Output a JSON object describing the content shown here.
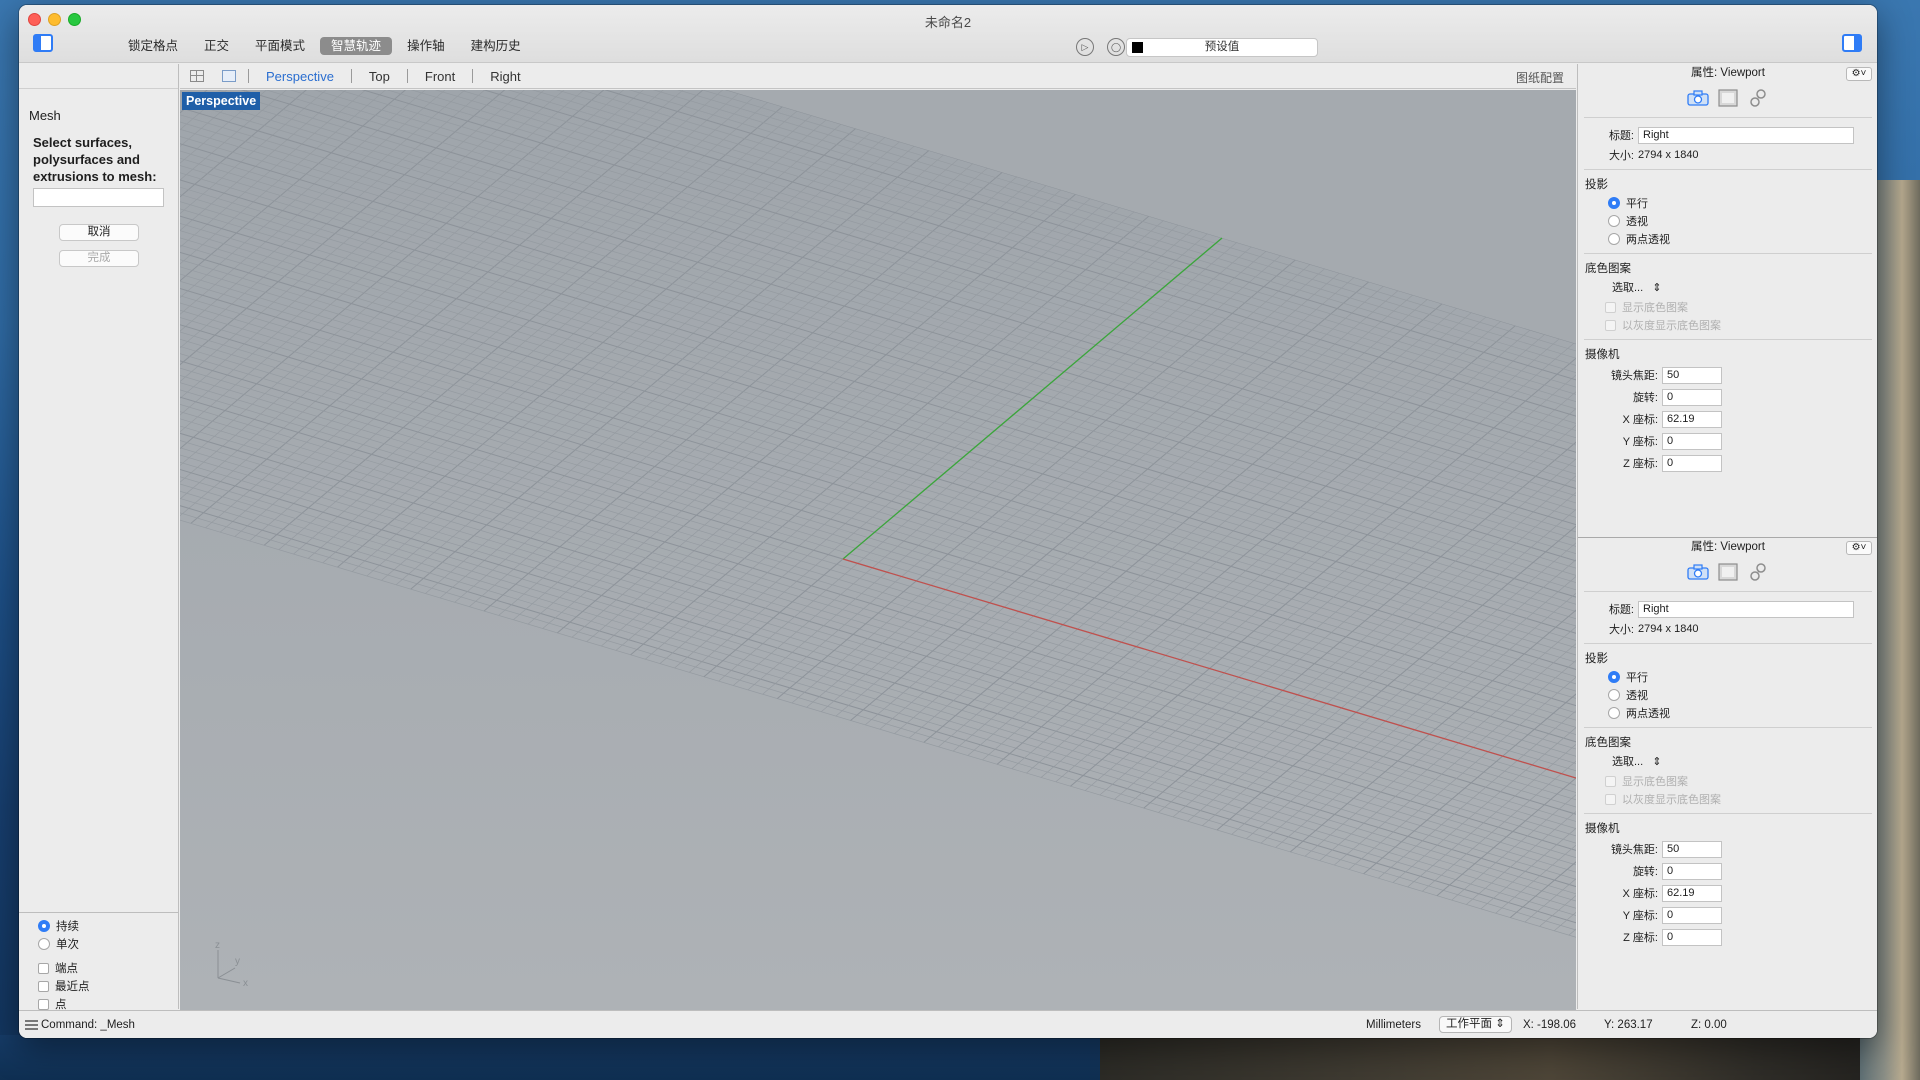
{
  "window": {
    "title": "未命名2",
    "modes": [
      "锁定格点",
      "正交",
      "平面模式",
      "智慧轨迹",
      "操作轴",
      "建构历史"
    ],
    "active_mode_index": 3,
    "preset_label": "预设值"
  },
  "command": {
    "name": "Mesh",
    "prompt": "Select surfaces, polysurfaces and extrusions to mesh:",
    "input_value": "",
    "cancel_label": "取消",
    "done_label": "完成",
    "osnap_radio": [
      "持续",
      "单次"
    ],
    "osnap_radio_selected": 0,
    "osnap_checks": [
      "端点",
      "最近点",
      "点"
    ]
  },
  "viewport_tabs": {
    "tabs": [
      "Perspective",
      "Top",
      "Front",
      "Right"
    ],
    "active_tab": "Perspective",
    "layout_label": "图纸配置"
  },
  "viewport": {
    "label": "Perspective",
    "axis_letters": {
      "z": "z",
      "y": "y",
      "x": "x"
    }
  },
  "properties": [
    {
      "header": "属性: Viewport",
      "title_label": "标题:",
      "title_value": "Right",
      "size_label": "大小:",
      "size_value": "2794 x 1840",
      "projection_title": "投影",
      "projection_options": [
        "平行",
        "透视",
        "两点透视"
      ],
      "projection_selected": 0,
      "wallpaper_title": "底色图案",
      "wallpaper_select": "选取...",
      "wallpaper_options": [
        "显示底色图案",
        "以灰度显示底色图案"
      ],
      "camera_title": "摄像机",
      "camera_fields": [
        {
          "label": "镜头焦距:",
          "value": "50"
        },
        {
          "label": "旋转:",
          "value": "0"
        },
        {
          "label": "X 座标:",
          "value": "62.19"
        },
        {
          "label": "Y 座标:",
          "value": "0"
        },
        {
          "label": "Z 座标:",
          "value": "0"
        }
      ]
    },
    {
      "header": "属性: Viewport",
      "title_label": "标题:",
      "title_value": "Right",
      "size_label": "大小:",
      "size_value": "2794 x 1840",
      "projection_title": "投影",
      "projection_options": [
        "平行",
        "透视",
        "两点透视"
      ],
      "projection_selected": 0,
      "wallpaper_title": "底色图案",
      "wallpaper_select": "选取...",
      "wallpaper_options": [
        "显示底色图案",
        "以灰度显示底色图案"
      ],
      "camera_title": "摄像机",
      "camera_fields": [
        {
          "label": "镜头焦距:",
          "value": "50"
        },
        {
          "label": "旋转:",
          "value": "0"
        },
        {
          "label": "X 座标:",
          "value": "62.19"
        },
        {
          "label": "Y 座标:",
          "value": "0"
        },
        {
          "label": "Z 座标:",
          "value": "0"
        }
      ]
    }
  ],
  "status": {
    "command_line": "Command: _Mesh",
    "units": "Millimeters",
    "cplane": "工作平面",
    "x": "X: -198.06",
    "y": "Y: 263.17",
    "z": "Z: 0.00"
  },
  "colors": {
    "accent": "#2f7cf6",
    "viewport_bg": "#a8adb2",
    "x_axis": "#c0504d",
    "y_axis": "#3aa63a",
    "viewport_label_bg": "#1f5fa8"
  },
  "icons": [
    "sidebar-left-icon",
    "sidebar-right-icon",
    "record-icon",
    "target-icon",
    "camera-icon",
    "viewport-frame-icon",
    "link-icon",
    "gear-icon"
  ]
}
